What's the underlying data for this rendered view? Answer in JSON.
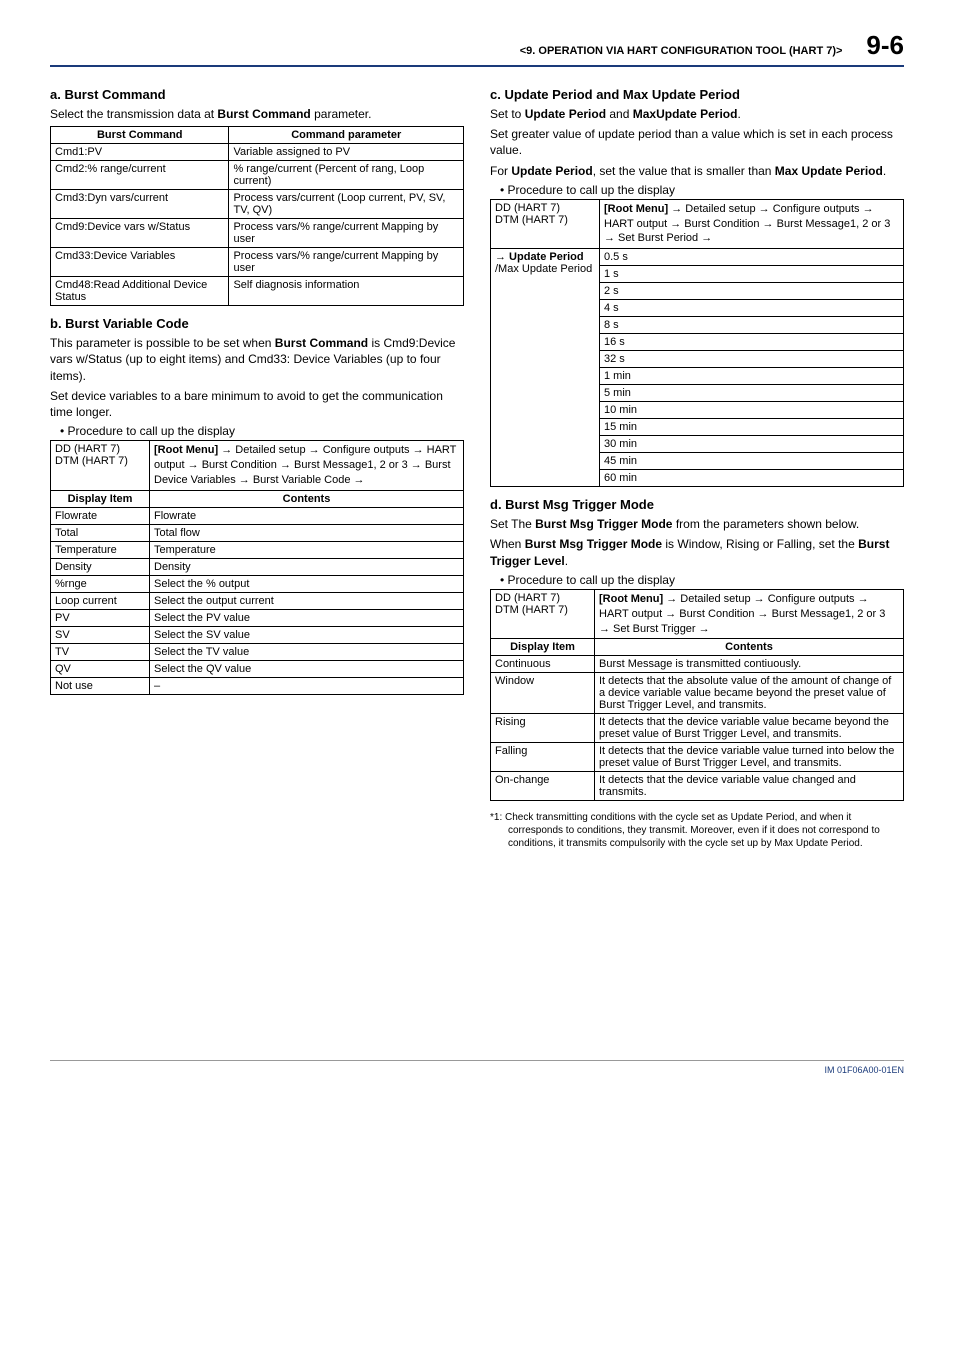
{
  "header": {
    "title": "<9.  OPERATION VIA HART CONFIGURATION TOOL (HART 7)>",
    "page_number": "9-6"
  },
  "left": {
    "a": {
      "heading": "a.   Burst Command",
      "intro_pre": "Select the transmission data at ",
      "intro_bold": "Burst Command",
      "intro_post": " parameter.",
      "table_head": {
        "c1": "Burst Command",
        "c2": "Command parameter"
      },
      "rows": [
        {
          "c1": "Cmd1:PV",
          "c2": "Variable assigned to PV"
        },
        {
          "c1": "Cmd2:% range/current",
          "c2": "% range/current (Percent of rang, Loop current)"
        },
        {
          "c1": "Cmd3:Dyn vars/current",
          "c2": "Process vars/current (Loop current, PV, SV, TV, QV)"
        },
        {
          "c1": "Cmd9:Device vars w/Status",
          "c2": "Process vars/% range/current Mapping by user"
        },
        {
          "c1": "Cmd33:Device Variables",
          "c2": "Process vars/% range/current Mapping by user"
        },
        {
          "c1": "Cmd48:Read Additional Device Status",
          "c2": "Self diagnosis information"
        }
      ]
    },
    "b": {
      "heading": "b.   Burst Variable Code",
      "p1_pre": "This parameter is possible to be set when ",
      "p1_bold": "Burst Command",
      "p1_post": " is Cmd9:Device vars w/Status (up to eight items) and Cmd33: Device Variables (up to four items).",
      "p2": "Set device variables to a bare minimum to avoid to get the communication time longer.",
      "bullet": "Procedure to call up the display",
      "path_label1": "DD (HART 7)",
      "path_label2": "DTM (HART 7)",
      "path_text": "[Root Menu] → Detailed setup → Configure outputs → HART output → Burst Condition → Burst Message1, 2 or 3 → Burst Device Variables → Burst Variable Code →",
      "table_head": {
        "c1": "Display Item",
        "c2": "Contents"
      },
      "rows": [
        {
          "c1": "Flowrate",
          "c2": "Flowrate"
        },
        {
          "c1": "Total",
          "c2": "Total flow"
        },
        {
          "c1": "Temperature",
          "c2": "Temperature"
        },
        {
          "c1": "Density",
          "c2": "Density"
        },
        {
          "c1": "%rnge",
          "c2": "Select the % output"
        },
        {
          "c1": "Loop current",
          "c2": "Select the output current"
        },
        {
          "c1": "PV",
          "c2": "Select the PV value"
        },
        {
          "c1": "SV",
          "c2": "Select the SV value"
        },
        {
          "c1": "TV",
          "c2": "Select the TV value"
        },
        {
          "c1": "QV",
          "c2": "Select the QV value"
        },
        {
          "c1": "Not use",
          "c2": "–"
        }
      ]
    }
  },
  "right": {
    "c": {
      "heading": "c.   Update Period and Max Update Period",
      "p1_pre": "Set to ",
      "p1_b1": "Update Period",
      "p1_mid": " and ",
      "p1_b2": "MaxUpdate Period",
      "p1_post": ".",
      "p2": "Set greater value of update period than a value which is set in each  process value.",
      "p3_pre": "For ",
      "p3_b1": "Update Period",
      "p3_mid": ", set the value that is smaller than ",
      "p3_b2": "Max Update Period",
      "p3_post": ".",
      "bullet": "Procedure to call up the display",
      "path_label1": "DD (HART 7)",
      "path_label2": "DTM (HART 7)",
      "path_text": "[Root Menu] → Detailed setup → Configure outputs → HART output → Burst Condition → Burst Message1, 2 or 3 → Set Burst Period →",
      "side_label_bold": "→ Update Period",
      "side_label_rest": "/Max Update Period",
      "values": [
        "0.5 s",
        "1 s",
        "2 s",
        "4 s",
        "8 s",
        "16 s",
        "32 s",
        "1 min",
        "5 min",
        "10 min",
        "15 min",
        "30 min",
        "45 min",
        "60 min"
      ]
    },
    "d": {
      "heading": "d.   Burst Msg Trigger Mode",
      "p1_pre": "Set The  ",
      "p1_bold": "Burst Msg Trigger Mode",
      "p1_post": " from the parameters shown below.",
      "p2_pre": "When ",
      "p2_b1": "Burst Msg Trigger Mode",
      "p2_mid": " is Window, Rising or Falling, set the ",
      "p2_b2": "Burst Trigger Level",
      "p2_post": ".",
      "bullet": "Procedure to call up the display",
      "path_label1": "DD (HART 7)",
      "path_label2": "DTM (HART 7)",
      "path_text": "[Root Menu] → Detailed setup → Configure outputs → HART output → Burst Condition → Burst Message1, 2 or 3 → Set Burst Trigger →",
      "table_head": {
        "c1": "Display Item",
        "c2": "Contents"
      },
      "rows": [
        {
          "c1": "Continuous",
          "c2": "Burst Message is transmitted contiuously."
        },
        {
          "c1": "Window",
          "c2": "It detects that the absolute value of the amount of change of a device variable value became beyond the preset value of Burst Trigger Level, and transmits."
        },
        {
          "c1": "Rising",
          "c2": "It detects that the device variable value became beyond the preset value of Burst Trigger Level, and transmits."
        },
        {
          "c1": "Falling",
          "c2": "It detects that the device variable value turned into below the preset value of Burst Trigger Level, and transmits."
        },
        {
          "c1": "On-change",
          "c2": "It detects that the device variable value changed and transmits."
        }
      ],
      "footnote": "*1: Check transmitting conditions with the cycle set as Update Period, and when it corresponds to conditions, they transmit. Moreover, even if it does not correspond to conditions, it transmits compulsorily with the cycle set up by Max Update Period."
    }
  },
  "footer": {
    "code": "IM 01F06A00-01EN"
  }
}
